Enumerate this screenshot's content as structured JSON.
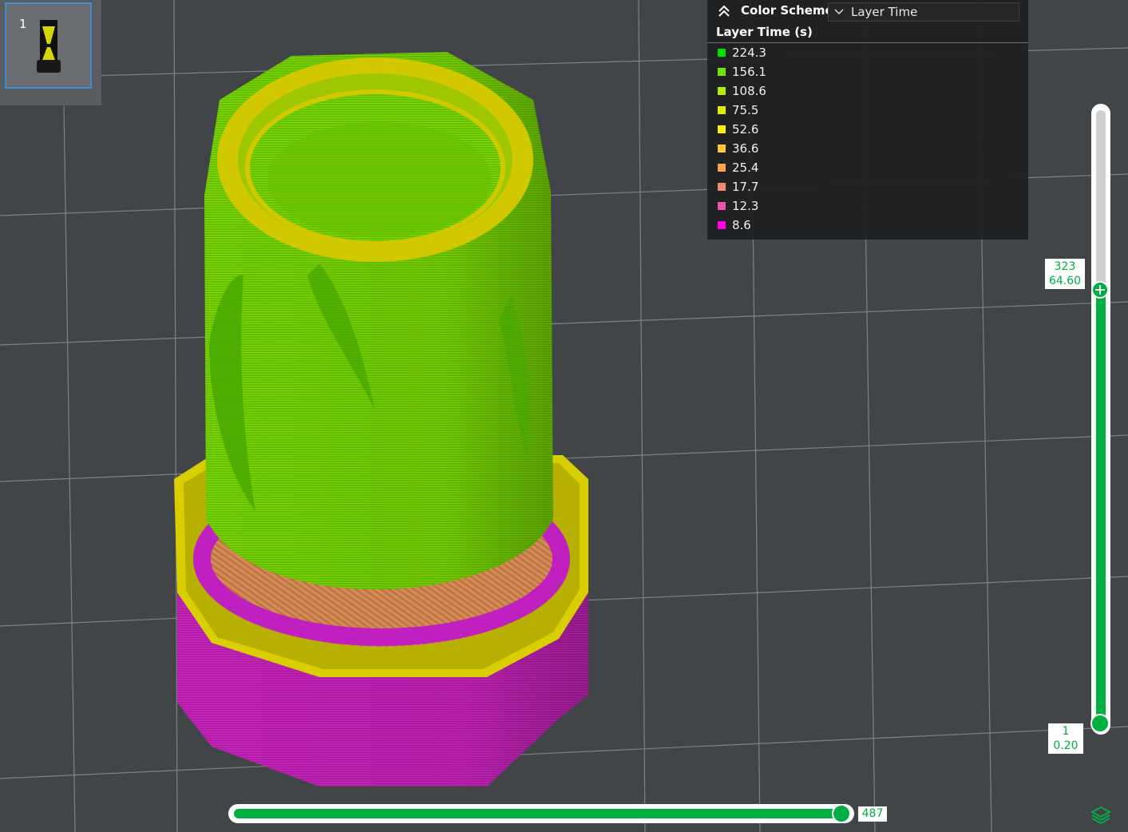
{
  "plate": {
    "number": "1"
  },
  "legend": {
    "color_scheme_label": "Color Scheme",
    "selected_scheme": "Layer Time",
    "subtitle": "Layer Time (s)",
    "items": [
      {
        "value": "224.3",
        "color": "#00e000"
      },
      {
        "value": "156.1",
        "color": "#76e600"
      },
      {
        "value": "108.6",
        "color": "#b2ea00"
      },
      {
        "value": "75.5",
        "color": "#dded00"
      },
      {
        "value": "52.6",
        "color": "#ffee00"
      },
      {
        "value": "36.6",
        "color": "#ffc933"
      },
      {
        "value": "25.4",
        "color": "#f8a74a"
      },
      {
        "value": "17.7",
        "color": "#f08a72"
      },
      {
        "value": "12.3",
        "color": "#ee55b0"
      },
      {
        "value": "8.6",
        "color": "#ff00e6"
      }
    ]
  },
  "layer_slider": {
    "top_layer": "323",
    "top_height": "64.60",
    "bottom_layer": "1",
    "bottom_height": "0.20",
    "max_layer": 323
  },
  "move_slider": {
    "value": "487"
  },
  "colors": {
    "accent": "#00ae42",
    "background": "#424548",
    "grid": "#7f8285",
    "selection": "#3a8fd6"
  },
  "icons": {
    "collapse": "double-chevron-up-icon",
    "dropdown": "chevron-down-icon",
    "layers": "layers-icon"
  }
}
